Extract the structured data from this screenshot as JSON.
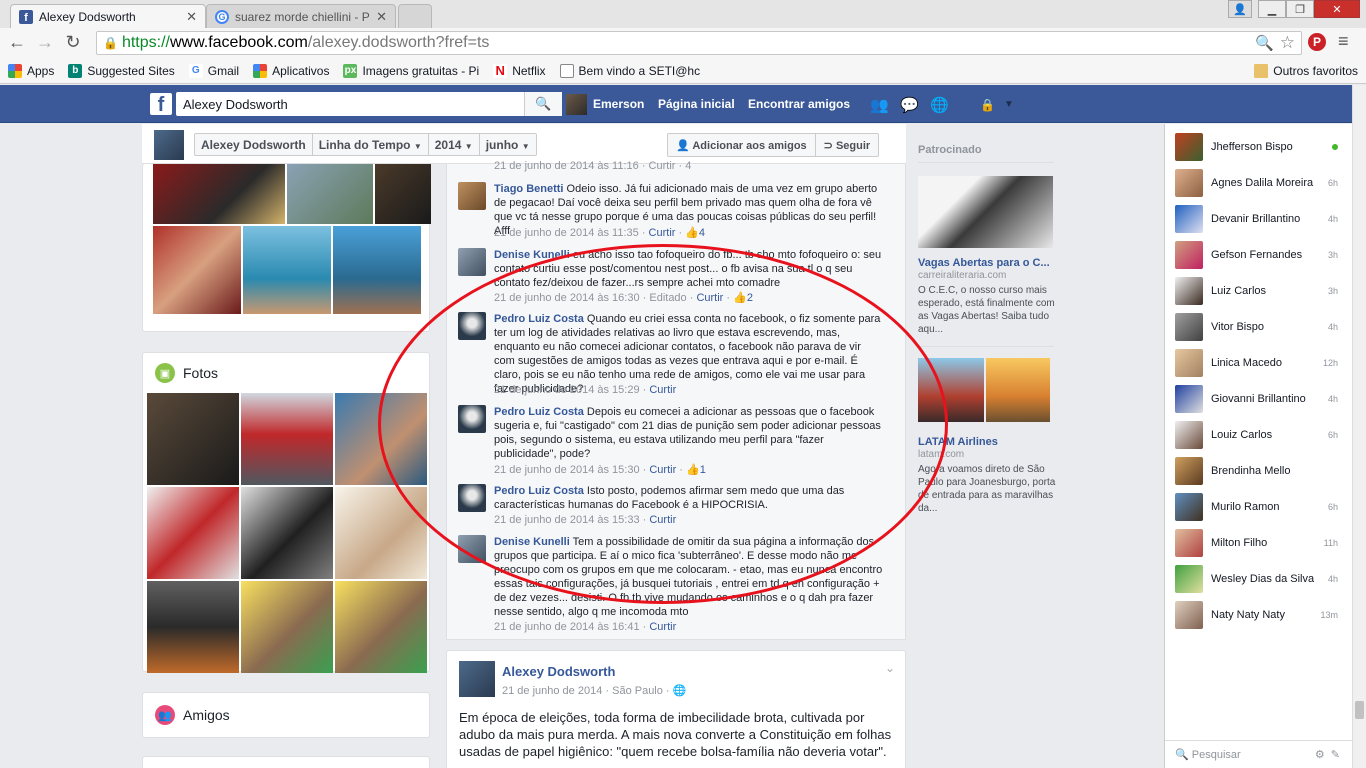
{
  "browser": {
    "tabs": [
      {
        "title": "Alexey Dodsworth"
      },
      {
        "title": "suarez morde chiellini - Pe"
      }
    ],
    "url": {
      "scheme": "https://",
      "host": "www.facebook.com",
      "path": "/alexey.dodsworth?fref=ts"
    }
  },
  "bookmarks": [
    {
      "label": "Apps",
      "icon": "apps-grid-icon"
    },
    {
      "label": "Suggested Sites",
      "icon": "bing-icon"
    },
    {
      "label": "Gmail",
      "icon": "google-icon"
    },
    {
      "label": "Aplicativos",
      "icon": "apps-grid-icon"
    },
    {
      "label": "Imagens gratuitas - Pi",
      "icon": "px-icon"
    },
    {
      "label": "Netflix",
      "icon": "netflix-icon"
    },
    {
      "label": "Bem vindo a SETI@hc",
      "icon": "page-icon"
    }
  ],
  "other_bookmarks": "Outros favoritos",
  "fbbar": {
    "search_value": "Alexey Dodsworth",
    "user": "Emerson",
    "home": "Página inicial",
    "find_friends": "Encontrar amigos"
  },
  "profile_header": {
    "name": "Alexey Dodsworth",
    "timeline": "Linha do Tempo",
    "year": "2014",
    "month": "junho",
    "add_friend": "Adicionar aos amigos",
    "follow": "Seguir"
  },
  "left": {
    "photos_title": "Fotos",
    "friends_title": "Amigos"
  },
  "comments": [
    {
      "meta": "21 de junho de 2014 às 11:16 · Curtir · 4"
    },
    {
      "author": "Tiago Benetti",
      "text": "Odeio isso. Já fui adicionado mais de uma vez em grupo aberto de pegacao! Daí você deixa seu perfil bem privado mas quem olha de fora vê que vc tá nesse grupo porque é uma das poucas coisas públicas do seu perfil! Afff",
      "time": "21 de junho de 2014 às 11:35",
      "action": "Curtir",
      "likes": "4"
    },
    {
      "author": "Denise Kunelli",
      "text": "eu acho isso tao fofoqueiro do fb... tb sho mto fofoqueiro o: seu contato curtiu esse post/comentou nest post... o fb avisa na sua tl o q seu contato fez/deixou de fazer...rs sempre achei mto comadre",
      "time": "21 de junho de 2014 às 16:30",
      "edited": "Editado",
      "action": "Curtir",
      "likes": "2"
    },
    {
      "author": "Pedro Luiz Costa",
      "text": "Quando eu criei essa conta no facebook, o fiz somente para ter um log de atividades relativas ao livro que estava escrevendo, mas, enquanto eu não comecei adicionar contatos, o facebook não parava de vir com sugestões de amigos todas as vezes que entrava aqui e por e-mail. É claro, pois se eu não tenho uma rede de amigos, como ele vai me usar para fazer publicidade?",
      "time": "21 de junho de 2014 às 15:29",
      "action": "Curtir"
    },
    {
      "author": "Pedro Luiz Costa",
      "text": "Depois eu comecei a adicionar as pessoas que o facebook sugeria e, fui \"castigado\" com 21 dias de punição sem poder adicionar pessoas pois, segundo o sistema, eu estava utilizando meu perfil para \"fazer publicidade\", pode?",
      "time": "21 de junho de 2014 às 15:30",
      "action": "Curtir",
      "likes": "1"
    },
    {
      "author": "Pedro Luiz Costa",
      "text": "Isto posto, podemos afirmar sem medo que uma das características humanas do Facebook é a HIPOCRISIA.",
      "time": "21 de junho de 2014 às 15:33",
      "action": "Curtir"
    },
    {
      "author": "Denise Kunelli",
      "text": "Tem a possibilidade de omitir da sua página a informação dos grupos que participa. E aí o mico fica 'subterrâneo'. E desse modo não me preocupo com os grupos em que me colocaram. - etao, mas eu nunca encontro essas tais configurações, já busquei tutoriais , entrei em td q eh configuração + de dez vezes... desisti. O fb tb vive mudando os caminhos e o q dah pra fazer nesse sentido, algo q me incomoda mto",
      "time": "21 de junho de 2014 às 16:41",
      "action": "Curtir"
    }
  ],
  "post": {
    "author": "Alexey Dodsworth",
    "date": "21 de junho de 2014",
    "location": "São Paulo",
    "text": "Em época de eleições, toda forma de imbecilidade brota, cultivada por adubo da mais pura merda. A mais nova converte a Constituição em folhas usadas de papel higiênico: \"quem recebe bolsa-família não deveria votar\"."
  },
  "sponsored": {
    "title": "Patrocinado",
    "ads": [
      {
        "title": "Vagas Abertas para o C...",
        "domain": "carreiraliteraria.com",
        "text": "O C.E.C, o nosso curso mais esperado, está finalmente com as Vagas Abertas! Saiba tudo aqu..."
      },
      {
        "title": "LATAM Airlines",
        "domain": "latam.com",
        "text": "Agora voamos direto de São Paulo para Joanesburgo, porta de entrada para as maravilhas da..."
      }
    ]
  },
  "chat": [
    {
      "name": "Jhefferson Bispo",
      "time": "",
      "online": true
    },
    {
      "name": "Agnes Dalila Moreira",
      "time": "6h"
    },
    {
      "name": "Devanir Brillantino",
      "time": "4h"
    },
    {
      "name": "Gefson Fernandes",
      "time": "3h"
    },
    {
      "name": "Luiz Carlos",
      "time": "3h"
    },
    {
      "name": "Vitor Bispo",
      "time": "4h"
    },
    {
      "name": "Linica Macedo",
      "time": "12h"
    },
    {
      "name": "Giovanni Brillantino",
      "time": "4h"
    },
    {
      "name": "Louiz Carlos",
      "time": "6h"
    },
    {
      "name": "Brendinha Mello",
      "time": ""
    },
    {
      "name": "Murilo Ramon",
      "time": "6h"
    },
    {
      "name": "Milton Filho",
      "time": "11h"
    },
    {
      "name": "Wesley Dias da Silva",
      "time": "4h"
    },
    {
      "name": "Naty Naty Naty",
      "time": "13m"
    }
  ],
  "chat_search": "Pesquisar",
  "colors": {
    "fb_blue": "#3b5998",
    "link": "#365899",
    "annotation_red": "#e8121d"
  }
}
